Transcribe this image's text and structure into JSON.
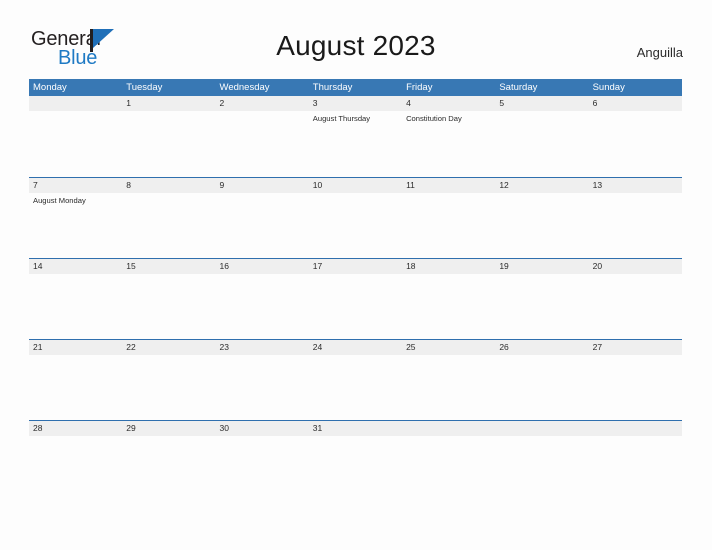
{
  "brand": {
    "name_top": "General",
    "name_bottom": "Blue",
    "flag_icon": "flag-triangle-icon",
    "accent_color": "#1f7ac4",
    "text_color": "#231f20"
  },
  "header": {
    "title": "August 2023",
    "locale": "Anguilla"
  },
  "calendar": {
    "header_bg": "#3878b4",
    "header_text_color": "#ffffff",
    "row_band_bg": "#efefef",
    "row_divider_color": "#2f6fae",
    "weekdays": [
      "Monday",
      "Tuesday",
      "Wednesday",
      "Thursday",
      "Friday",
      "Saturday",
      "Sunday"
    ],
    "weeks": [
      {
        "days": [
          {
            "date": "",
            "events": []
          },
          {
            "date": "1",
            "events": []
          },
          {
            "date": "2",
            "events": []
          },
          {
            "date": "3",
            "events": [
              "August Thursday"
            ]
          },
          {
            "date": "4",
            "events": [
              "Constitution Day"
            ]
          },
          {
            "date": "5",
            "events": []
          },
          {
            "date": "6",
            "events": []
          }
        ]
      },
      {
        "days": [
          {
            "date": "7",
            "events": [
              "August Monday"
            ]
          },
          {
            "date": "8",
            "events": []
          },
          {
            "date": "9",
            "events": []
          },
          {
            "date": "10",
            "events": []
          },
          {
            "date": "11",
            "events": []
          },
          {
            "date": "12",
            "events": []
          },
          {
            "date": "13",
            "events": []
          }
        ]
      },
      {
        "days": [
          {
            "date": "14",
            "events": []
          },
          {
            "date": "15",
            "events": []
          },
          {
            "date": "16",
            "events": []
          },
          {
            "date": "17",
            "events": []
          },
          {
            "date": "18",
            "events": []
          },
          {
            "date": "19",
            "events": []
          },
          {
            "date": "20",
            "events": []
          }
        ]
      },
      {
        "days": [
          {
            "date": "21",
            "events": []
          },
          {
            "date": "22",
            "events": []
          },
          {
            "date": "23",
            "events": []
          },
          {
            "date": "24",
            "events": []
          },
          {
            "date": "25",
            "events": []
          },
          {
            "date": "26",
            "events": []
          },
          {
            "date": "27",
            "events": []
          }
        ]
      },
      {
        "days": [
          {
            "date": "28",
            "events": []
          },
          {
            "date": "29",
            "events": []
          },
          {
            "date": "30",
            "events": []
          },
          {
            "date": "31",
            "events": []
          },
          {
            "date": "",
            "events": []
          },
          {
            "date": "",
            "events": []
          },
          {
            "date": "",
            "events": []
          }
        ]
      }
    ]
  }
}
